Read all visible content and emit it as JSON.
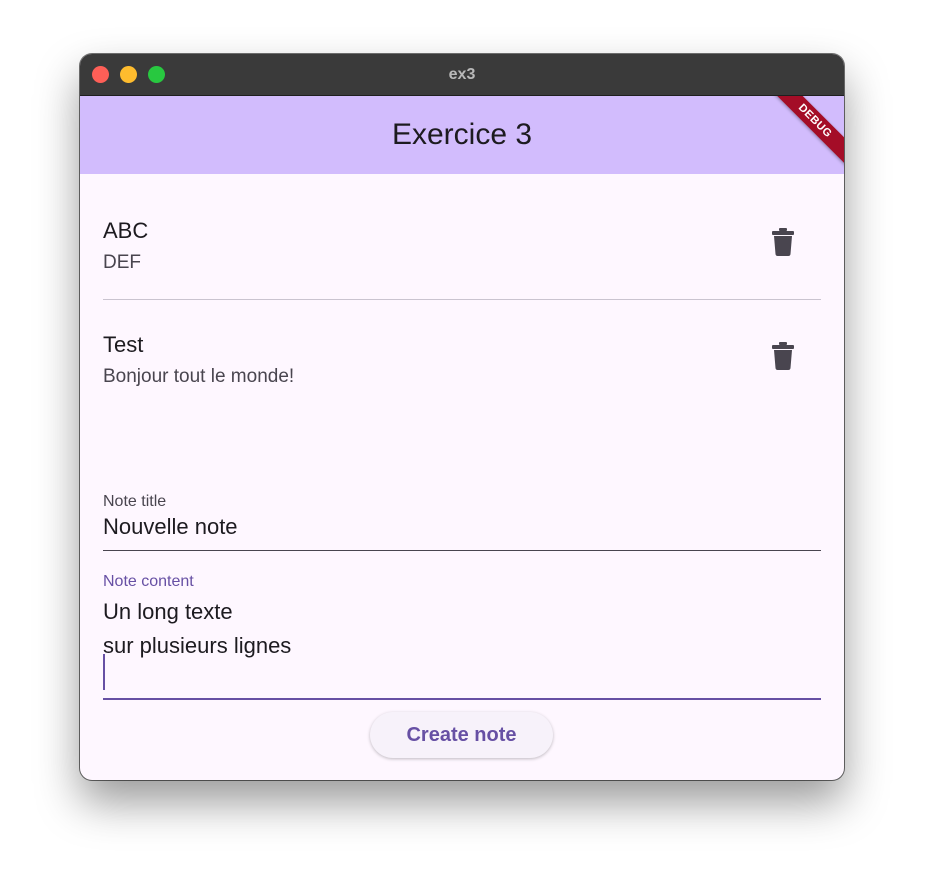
{
  "window": {
    "title": "ex3",
    "controls": [
      "close",
      "minimize",
      "maximize"
    ]
  },
  "appbar": {
    "title": "Exercice 3",
    "debug_banner": "DEBUG"
  },
  "notes": [
    {
      "title": "ABC",
      "content": "DEF",
      "delete_icon": "trash-icon"
    },
    {
      "title": "Test",
      "content": "Bonjour tout le monde!",
      "delete_icon": "trash-icon"
    }
  ],
  "form": {
    "title_field": {
      "label": "Note title",
      "value": "Nouvelle note"
    },
    "content_field": {
      "label": "Note content",
      "value": "Un long texte\nsur plusieurs lignes\n"
    },
    "create_button": "Create note"
  },
  "colors": {
    "appbar": "#d2bcfd",
    "background": "#fef7ff",
    "primary": "#6750a4",
    "debug": "#a40d27"
  }
}
